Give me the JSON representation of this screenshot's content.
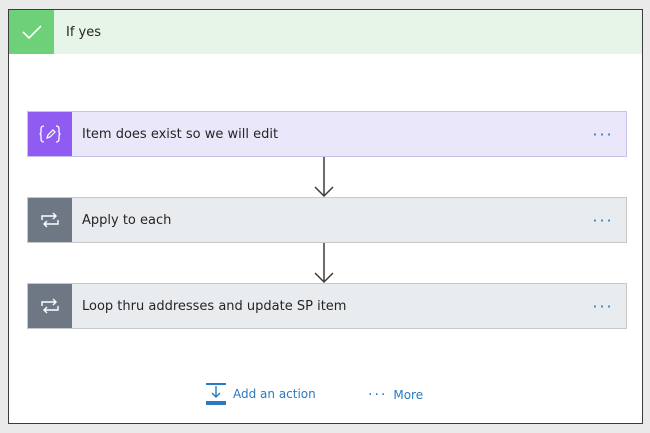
{
  "condition": {
    "title": "If yes",
    "icon": "checkmark-icon",
    "color": "#6fd07a"
  },
  "cards": [
    {
      "title": "Item does exist so we will edit",
      "icon": "compose-icon",
      "color": "#8f5bf1",
      "more": "···"
    },
    {
      "title": "Apply to each",
      "icon": "loop-icon",
      "color": "#6d7884",
      "more": "···"
    },
    {
      "title": "Loop thru addresses and update SP item",
      "icon": "loop-icon",
      "color": "#6d7884",
      "more": "···"
    }
  ],
  "footer": {
    "add_action_label": "Add an action",
    "more_label": "More",
    "more_dots": "···"
  },
  "colors": {
    "accent": "#2b79c2",
    "header_bg": "#e6f5e7"
  }
}
